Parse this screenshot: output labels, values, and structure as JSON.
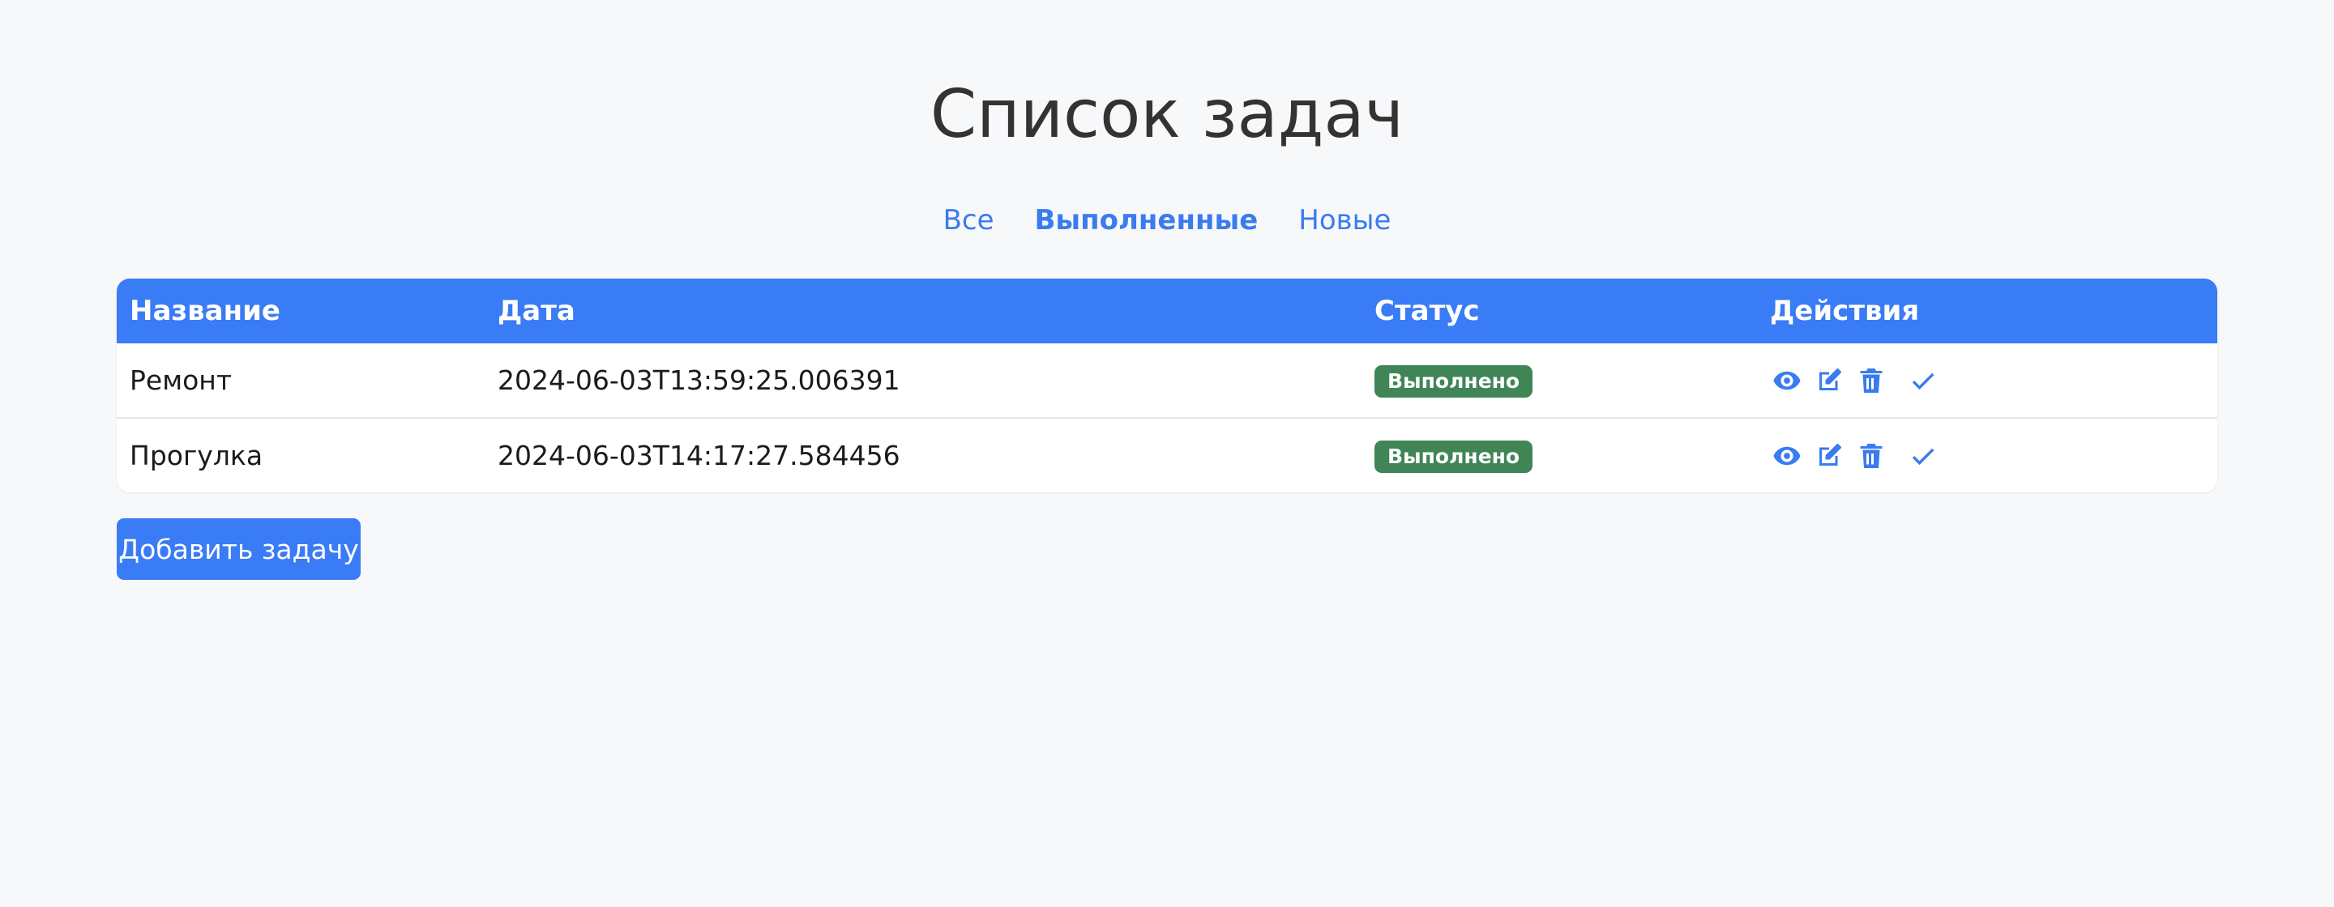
{
  "page": {
    "title": "Список задач"
  },
  "filters": {
    "all": "Все",
    "done": "Выполненные",
    "new": "Новые",
    "active": "done"
  },
  "table": {
    "headers": {
      "name": "Название",
      "date": "Дата",
      "status": "Статус",
      "actions": "Действия"
    },
    "rows": [
      {
        "name": "Ремонт",
        "date": "2024-06-03T13:59:25.006391",
        "status": "Выполнено",
        "actions": [
          "eye-icon",
          "edit-icon",
          "trash-icon",
          "check-icon"
        ]
      },
      {
        "name": "Прогулка",
        "date": "2024-06-03T14:17:27.584456",
        "status": "Выполнено",
        "actions": [
          "eye-icon",
          "edit-icon",
          "trash-icon",
          "check-icon"
        ]
      }
    ]
  },
  "buttons": {
    "add_task": "Добавить задачу"
  },
  "colors": {
    "accent": "#3a7bf6",
    "status_done": "#3f8556",
    "background": "#f7f8fa"
  }
}
